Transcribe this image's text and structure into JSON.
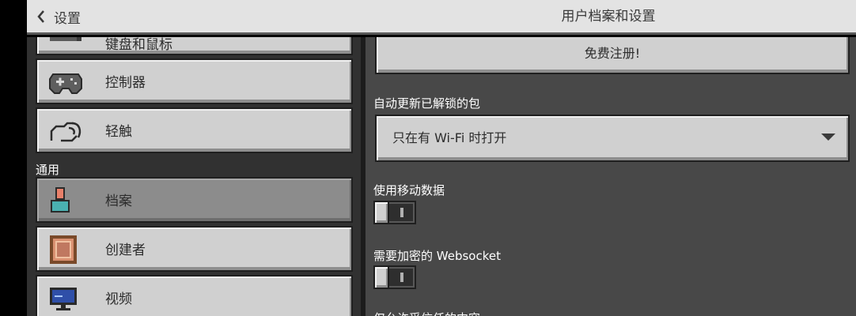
{
  "header": {
    "back_label": "设置",
    "title": "用户档案和设置"
  },
  "sidebar": {
    "items": [
      {
        "label": "键盘和鼠标",
        "icon": "keyboard-mouse-icon"
      },
      {
        "label": "控制器",
        "icon": "gamepad-icon"
      },
      {
        "label": "轻触",
        "icon": "touch-hand-icon"
      }
    ],
    "general_heading": "通用",
    "general_items": [
      {
        "label": "档案",
        "icon": "profile-icon",
        "active": true
      },
      {
        "label": "创建者",
        "icon": "creator-icon",
        "active": false
      },
      {
        "label": "视频",
        "icon": "video-monitor-icon",
        "active": false
      }
    ]
  },
  "main": {
    "signup_button": "免费注册!",
    "auto_update_label": "自动更新已解锁的包",
    "auto_update_value": "只在有 Wi-Fi 时打开",
    "mobile_data_label": "使用移动数据",
    "mobile_data_enabled": false,
    "websocket_label": "需要加密的 Websocket",
    "websocket_enabled": false,
    "trusted_content_label": "仅允许受信任的内容"
  },
  "colors": {
    "titlebar": "#e3e3e3",
    "sidebar_bg": "#313131",
    "content_bg": "#484848",
    "button_face": "#d0d0d0",
    "active_item": "#8c8c8c"
  }
}
